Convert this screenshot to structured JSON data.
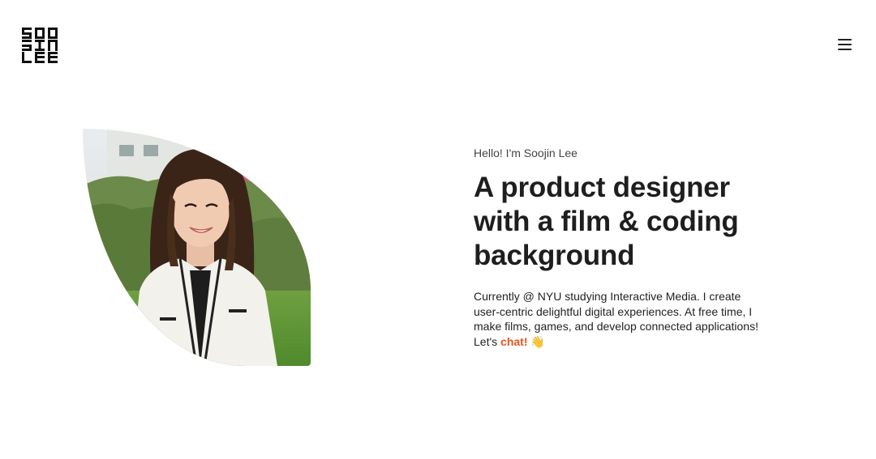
{
  "header": {
    "logo_text": "SOO JIN LEE",
    "menu_icon": "hamburger-menu-icon"
  },
  "hero": {
    "photo_alt": "Portrait photo",
    "greeting": "Hello! I'm Soojin Lee",
    "headline": "A product designer with a film & coding background",
    "bio_text": "Currently @ NYU studying Interactive Media. I create user-centric delightful digital experiences. At free time, I make films, games, and develop connected applications! Let's ",
    "chat_link": "chat!",
    "emoji": "👋"
  },
  "colors": {
    "accent": "#e0541f",
    "text": "#1e1e1e",
    "background": "#ffffff"
  }
}
